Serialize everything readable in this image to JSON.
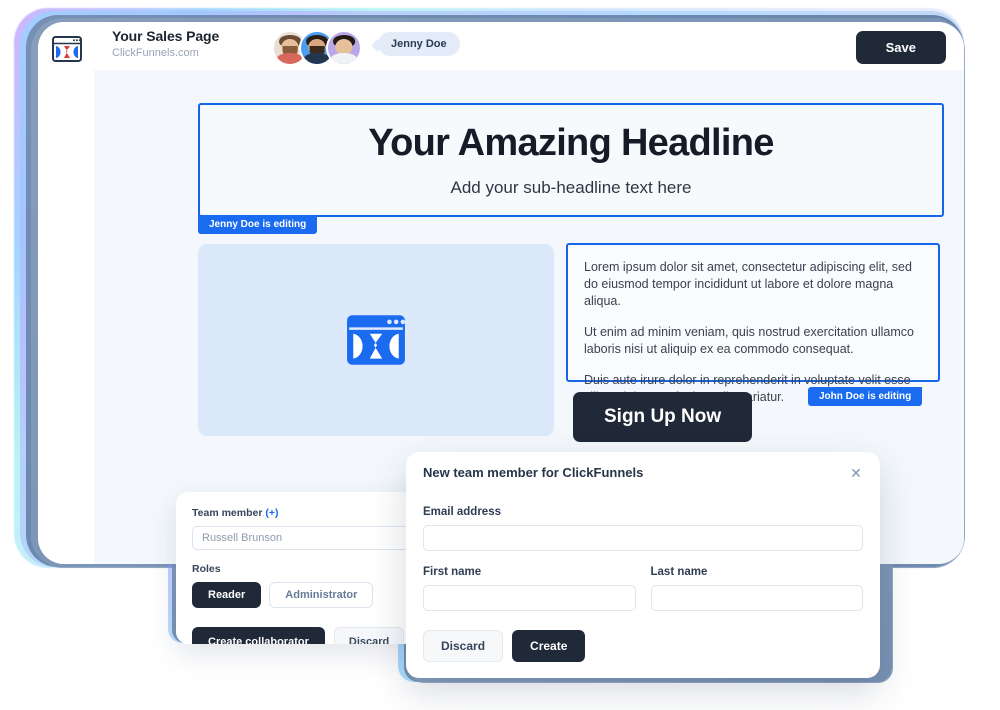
{
  "header": {
    "logo_icon": "clickfunnels-logo-icon",
    "page_title": "Your Sales Page",
    "page_domain": "ClickFunnels.com",
    "avatars": [
      {
        "name": "collaborator-1"
      },
      {
        "name": "collaborator-2"
      },
      {
        "name": "collaborator-3"
      }
    ],
    "name_chip": "Jenny Doe",
    "save_label": "Save"
  },
  "canvas": {
    "headline": "Your Amazing Headline",
    "subheadline": "Add your sub-headline text here",
    "jenny_badge": "Jenny Doe is editing",
    "john_badge": "John Doe is editing",
    "image_placeholder_icon": "clickfunnels-logo-icon",
    "paragraphs": [
      "Lorem ipsum dolor sit amet, consectetur adipiscing elit, sed do eiusmod tempor incididunt ut labore et dolore magna aliqua.",
      "Ut enim ad minim veniam, quis nostrud exercitation ullamco laboris nisi ut aliquip ex ea commodo consequat.",
      "Duis aute irure dolor in reprehenderit in voluptate velit esse cillum dolore eu fugiat nulla pariatur."
    ],
    "cta_label": "Sign Up Now"
  },
  "collaborator_card": {
    "member_label": "Team member",
    "member_plus": "(+)",
    "member_value": "Russell Brunson",
    "roles_label": "Roles",
    "roles": [
      {
        "label": "Reader",
        "active": true
      },
      {
        "label": "Administrator",
        "active": false
      }
    ],
    "create_label": "Create collaborator",
    "discard_label": "Discard"
  },
  "modal": {
    "title": "New team member for ClickFunnels",
    "close_icon": "close-icon",
    "email_label": "Email address",
    "email_value": "",
    "first_name_label": "First name",
    "first_name_value": "",
    "last_name_label": "Last name",
    "last_name_value": "",
    "discard_label": "Discard",
    "create_label": "Create"
  },
  "colors": {
    "accent_blue": "#1a6bf0",
    "dark_button": "#1f2937",
    "canvas_bg": "#f4f8fc",
    "image_panel_bg": "#dce9fb",
    "chip_bg": "#e3ecf8"
  }
}
